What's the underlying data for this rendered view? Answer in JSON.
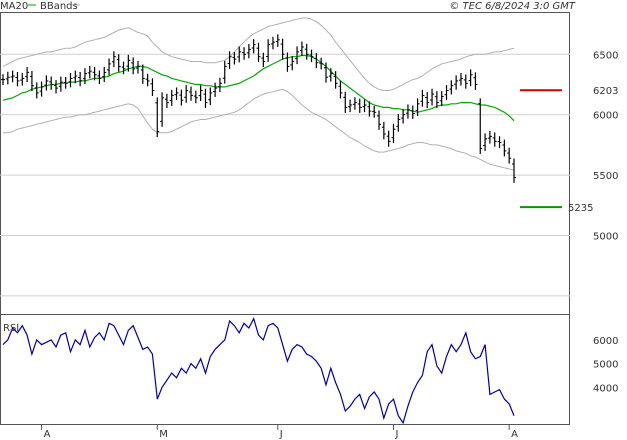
{
  "chart_data": [
    {
      "type": "ohlc",
      "legend": [
        {
          "label": "MA20",
          "color": "#00aa00"
        },
        {
          "label": "BBands",
          "color": "#b0b0b0"
        }
      ],
      "watermark": "© TEC 6/8/2024 3:0 GMT",
      "y_axis": {
        "range": [
          4350,
          6850
        ],
        "ticks": [
          6500,
          6000,
          5500,
          5000
        ],
        "tick_labels": [
          "6500",
          "6000",
          "5500",
          "5000"
        ],
        "gridlines": [
          6500,
          6000,
          5500,
          5000,
          4500
        ]
      },
      "x_axis": {
        "tick_labels": [
          "A",
          "M",
          "J",
          "J",
          "A"
        ],
        "tick_index": [
          8,
          32,
          57,
          81,
          105
        ]
      },
      "levels": [
        {
          "label": "6203",
          "value": 6203,
          "color": "#cc0000"
        },
        {
          "label": "5235",
          "value": 5235,
          "color": "#009900"
        }
      ],
      "series": {
        "close": [
          6290,
          6310,
          6320,
          6280,
          6300,
          6350,
          6240,
          6180,
          6230,
          6280,
          6250,
          6220,
          6270,
          6260,
          6300,
          6320,
          6280,
          6340,
          6360,
          6330,
          6300,
          6350,
          6420,
          6480,
          6400,
          6380,
          6450,
          6380,
          6400,
          6300,
          6280,
          6200,
          5860,
          6140,
          6100,
          6160,
          6180,
          6120,
          6200,
          6160,
          6140,
          6200,
          6100,
          6180,
          6220,
          6260,
          6400,
          6480,
          6460,
          6520,
          6500,
          6540,
          6580,
          6480,
          6440,
          6580,
          6600,
          6620,
          6500,
          6400,
          6440,
          6520,
          6560,
          6500,
          6480,
          6430,
          6420,
          6310,
          6340,
          6260,
          6180,
          6060,
          6080,
          6100,
          6060,
          6080,
          6030,
          6020,
          5920,
          5840,
          5780,
          5880,
          5960,
          6000,
          6040,
          6010,
          6090,
          6160,
          6100,
          6170,
          6100,
          6150,
          6200,
          6240,
          6280,
          6300,
          6260,
          6330,
          6250,
          5720,
          5800,
          5820,
          5780,
          5770,
          5700,
          5640,
          5480
        ],
        "ma20": [
          6120,
          6130,
          6140,
          6160,
          6180,
          6190,
          6210,
          6220,
          6230,
          6240,
          6250,
          6250,
          6260,
          6260,
          6270,
          6270,
          6280,
          6280,
          6290,
          6300,
          6300,
          6310,
          6320,
          6340,
          6350,
          6360,
          6380,
          6390,
          6400,
          6400,
          6390,
          6370,
          6350,
          6330,
          6320,
          6300,
          6290,
          6280,
          6270,
          6260,
          6250,
          6250,
          6240,
          6240,
          6230,
          6230,
          6230,
          6240,
          6250,
          6260,
          6280,
          6300,
          6320,
          6350,
          6380,
          6400,
          6420,
          6440,
          6460,
          6470,
          6480,
          6480,
          6490,
          6490,
          6480,
          6460,
          6430,
          6400,
          6360,
          6320,
          6280,
          6250,
          6220,
          6190,
          6160,
          6130,
          6100,
          6080,
          6070,
          6060,
          6060,
          6050,
          6050,
          6040,
          6040,
          6030,
          6020,
          6030,
          6040,
          6050,
          6070,
          6080,
          6080,
          6090,
          6090,
          6100,
          6100,
          6100,
          6090,
          6080,
          6080,
          6070,
          6060,
          6040,
          6020,
          5990,
          5950
        ],
        "bb_upper": [
          6400,
          6420,
          6440,
          6460,
          6470,
          6480,
          6490,
          6500,
          6510,
          6520,
          6520,
          6530,
          6540,
          6550,
          6550,
          6560,
          6580,
          6600,
          6610,
          6620,
          6630,
          6640,
          6660,
          6680,
          6700,
          6710,
          6720,
          6700,
          6680,
          6670,
          6650,
          6600,
          6560,
          6520,
          6500,
          6480,
          6470,
          6460,
          6450,
          6440,
          6440,
          6440,
          6430,
          6430,
          6430,
          6440,
          6450,
          6480,
          6520,
          6560,
          6600,
          6640,
          6670,
          6690,
          6710,
          6730,
          6740,
          6750,
          6760,
          6770,
          6780,
          6790,
          6800,
          6800,
          6790,
          6770,
          6740,
          6700,
          6660,
          6600,
          6550,
          6500,
          6450,
          6400,
          6350,
          6300,
          6260,
          6230,
          6210,
          6200,
          6200,
          6210,
          6230,
          6250,
          6270,
          6290,
          6300,
          6320,
          6350,
          6380,
          6400,
          6420,
          6430,
          6440,
          6450,
          6460,
          6480,
          6490,
          6500,
          6500,
          6500,
          6510,
          6520,
          6520,
          6530,
          6540,
          6550
        ],
        "bb_lower": [
          5850,
          5850,
          5860,
          5880,
          5890,
          5900,
          5910,
          5920,
          5930,
          5940,
          5950,
          5960,
          5970,
          5980,
          5980,
          5990,
          6000,
          6000,
          6010,
          6020,
          6030,
          6040,
          6050,
          6060,
          6070,
          6080,
          6090,
          6080,
          6050,
          5990,
          5930,
          5880,
          5850,
          5850,
          5850,
          5860,
          5880,
          5900,
          5920,
          5940,
          5950,
          5960,
          5960,
          5970,
          5980,
          5990,
          6000,
          6010,
          6020,
          6040,
          6070,
          6100,
          6130,
          6150,
          6170,
          6180,
          6190,
          6200,
          6210,
          6190,
          6160,
          6120,
          6080,
          6050,
          6020,
          6000,
          5980,
          5960,
          5930,
          5900,
          5870,
          5840,
          5810,
          5790,
          5770,
          5740,
          5720,
          5700,
          5690,
          5690,
          5700,
          5710,
          5720,
          5730,
          5750,
          5760,
          5770,
          5770,
          5760,
          5750,
          5750,
          5740,
          5730,
          5720,
          5700,
          5690,
          5680,
          5660,
          5650,
          5630,
          5610,
          5590,
          5580,
          5570,
          5560,
          5550,
          5540
        ]
      }
    },
    {
      "type": "line",
      "series_label": "RSI",
      "y_axis": {
        "range": [
          2450,
          7050
        ],
        "ticks": [
          6000,
          5000,
          4000
        ],
        "tick_labels": [
          "6000",
          "5000",
          "4000"
        ]
      },
      "series": {
        "rsi": [
          5800,
          6000,
          6500,
          6300,
          6600,
          6200,
          5400,
          6000,
          5800,
          5900,
          6000,
          5700,
          6200,
          6300,
          5500,
          6000,
          5800,
          6400,
          5700,
          6100,
          6300,
          6000,
          6700,
          6600,
          6200,
          5800,
          6400,
          6600,
          6100,
          5600,
          5700,
          5400,
          3500,
          4000,
          4300,
          4600,
          4400,
          4800,
          4600,
          5000,
          4800,
          5200,
          4600,
          5300,
          5600,
          5800,
          6000,
          6800,
          6600,
          6300,
          6700,
          6500,
          6900,
          6200,
          6000,
          6600,
          6700,
          6500,
          5800,
          5100,
          5600,
          5800,
          5700,
          5400,
          5300,
          5100,
          4800,
          4100,
          4800,
          4200,
          3700,
          3000,
          3200,
          3500,
          3700,
          3100,
          3600,
          3800,
          3500,
          2700,
          3300,
          3500,
          2800,
          2500,
          3200,
          3800,
          4200,
          4500,
          5500,
          5800,
          4900,
          4600,
          5300,
          5800,
          5500,
          5800,
          6300,
          5500,
          5200,
          5300,
          5800,
          3700,
          3800,
          3900,
          3500,
          3300,
          2800
        ]
      }
    }
  ]
}
